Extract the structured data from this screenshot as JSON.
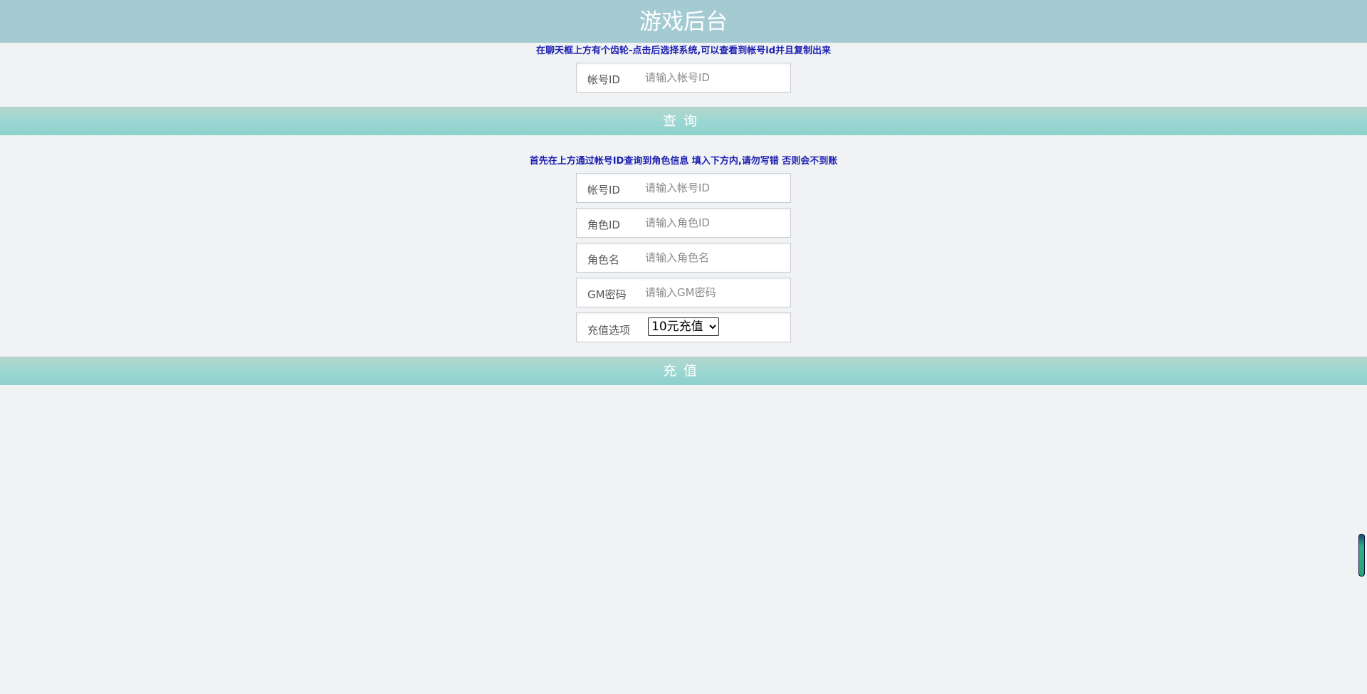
{
  "header": {
    "title": "游戏后台"
  },
  "query_section": {
    "notice": "在聊天框上方有个齿轮-点击后选择系统,可以查看到帐号id并且复制出来",
    "account_field": {
      "label": "帐号ID",
      "placeholder": "请输入帐号ID",
      "value": ""
    },
    "query_button": "查询"
  },
  "recharge_section": {
    "notice": "首先在上方通过帐号ID查询到角色信息 填入下方内,请勿写错 否则会不到账",
    "fields": {
      "account": {
        "label": "帐号ID",
        "placeholder": "请输入帐号ID",
        "value": ""
      },
      "role_id": {
        "label": "角色ID",
        "placeholder": "请输入角色ID",
        "value": ""
      },
      "role_name": {
        "label": "角色名",
        "placeholder": "请输入角色名",
        "value": ""
      },
      "gm_password": {
        "label": "GM密码",
        "placeholder": "请输入GM密码",
        "value": ""
      }
    },
    "recharge_option": {
      "label": "充值选项",
      "selected": "10元充值"
    },
    "recharge_button": "充值"
  },
  "colors": {
    "header_bg": "#a4cad2",
    "bar_bg": "#9cd7d2",
    "notice_text": "#1a1fb0",
    "page_bg": "#f1f2f4"
  }
}
